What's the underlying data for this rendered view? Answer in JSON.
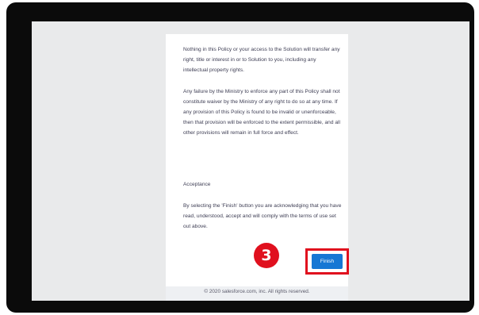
{
  "policy": {
    "paragraph_1": "Nothing in this Policy or your access to the Solution will transfer any right, title or interest in or to Solution to you, including any intellectual property rights.",
    "paragraph_2": "Any failure by the Ministry to enforce any part of this Policy shall not constitute waiver by the Ministry of any right to do so at any time. If any provision of this Policy is found to be invalid or unenforceable, then that provision will be enforced to the extent permissible, and all other provisions will remain in full force and effect.",
    "acceptance_heading": "Acceptance",
    "paragraph_3": "By selecting the 'Finish' button you are acknowledging that you have read, understood, accept and will comply with the terms of use set out above."
  },
  "actions": {
    "finish_label": "Finish"
  },
  "annotation": {
    "step_number": "3",
    "highlight_color": "#e0101e"
  },
  "footer": {
    "copyright": "© 2020 salesforce.com, inc. All rights reserved."
  },
  "colors": {
    "button": "#1677d4",
    "text": "#3e3e54",
    "screen_background": "#e9eaeb",
    "frame": "#0b0b0b"
  }
}
